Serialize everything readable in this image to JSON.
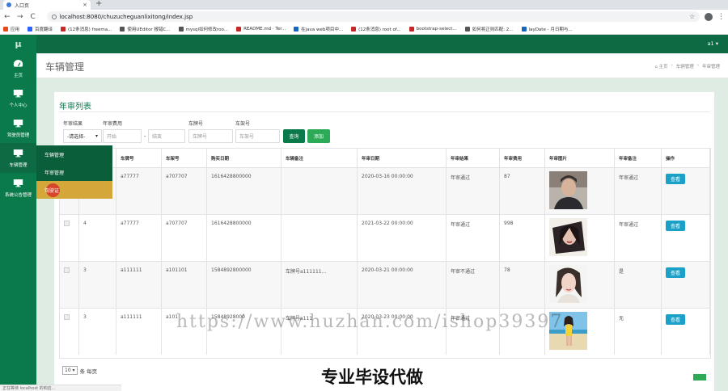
{
  "browser": {
    "tab_title": "入口页",
    "tab_close": "×",
    "new_tab": "+",
    "back": "←",
    "forward": "→",
    "reload": "C",
    "url": "localhost:8080/chuzucheguanlixitong/index.jsp",
    "star": "☆",
    "menu": "⋮",
    "bookmarks": [
      {
        "label": "应用",
        "color": "#e64a19"
      },
      {
        "label": "百度翻译",
        "color": "#2962ff"
      },
      {
        "label": "(12条消息) freema...",
        "color": "#c62828"
      },
      {
        "label": "使用UEditor 报错C...",
        "color": "#555555"
      },
      {
        "label": "mysql如何修改roo...",
        "color": "#555555"
      },
      {
        "label": "README.md · Ter...",
        "color": "#c62828"
      },
      {
        "label": "在java web项目中...",
        "color": "#1565c0"
      },
      {
        "label": "(12条消息) root of...",
        "color": "#c62828"
      },
      {
        "label": "bootstrap-select...",
        "color": "#c62828"
      },
      {
        "label": "如何将正则匹配: 2...",
        "color": "#555555"
      },
      {
        "label": "layDate - 月日期与...",
        "color": "#1565c0"
      }
    ]
  },
  "app": {
    "logo": "μ",
    "user": "a1 ▾",
    "sidebar": [
      {
        "label": "主页",
        "icon": "dashboard-icon"
      },
      {
        "label": "个人中心",
        "icon": "monitor-icon"
      },
      {
        "label": "驾驶员管理",
        "icon": "monitor-icon"
      },
      {
        "label": "车辆管理",
        "icon": "monitor-icon"
      },
      {
        "label": "系统公告管理",
        "icon": "monitor-icon"
      }
    ],
    "submenu": [
      "车辆管理",
      "年审管理",
      "驾驶证"
    ]
  },
  "page": {
    "title": "车辆管理",
    "breadcrumb": [
      "⌂ 主页",
      "›",
      "车辆管理",
      "›",
      "年审管理"
    ]
  },
  "panel": {
    "title": "年审列表",
    "filters": {
      "result_label": "年审结果",
      "result_value": "-请选择-",
      "fee_label": "年审费用",
      "fee_start_placeholder": "开始",
      "fee_sep": "-",
      "fee_end_placeholder": "结束",
      "plate_label": "车牌号",
      "plate_placeholder": "车牌号",
      "frame_label": "车架号",
      "frame_placeholder": "车架号",
      "search_btn": "查询",
      "add_btn": "添加"
    },
    "columns": [
      "",
      "",
      "车牌号",
      "车架号",
      "购买日期",
      "车辆备注",
      "年审日期",
      "年审结果",
      "年审费用",
      "年审图片",
      "年审备注",
      "操作"
    ],
    "rows": [
      {
        "idx": "",
        "plate": "a77777",
        "frame": "a707707",
        "buy_date": "1616428800000",
        "note": "",
        "date": "2020-03-16 00:00:00",
        "result": "年审通过",
        "fee": "87",
        "remark": "年审通过",
        "action": "查看",
        "photo": "man"
      },
      {
        "idx": "4",
        "plate": "a77777",
        "frame": "a707707",
        "buy_date": "1616428800000",
        "note": "",
        "date": "2021-03-22 00:00:00",
        "result": "年审通过",
        "fee": "998",
        "remark": "年审通过",
        "action": "查看",
        "photo": "woman-dark"
      },
      {
        "idx": "3",
        "plate": "a111111",
        "frame": "a101101",
        "buy_date": "1584892800000",
        "note": "车牌号a111111...",
        "date": "2020-03-21 00:00:00",
        "result": "年审不通过",
        "fee": "78",
        "remark": "是",
        "action": "查看",
        "photo": "woman-light"
      },
      {
        "idx": "3",
        "plate": "a111111",
        "frame": "a101",
        "buy_date": "15848928000",
        "note": "车牌号a111",
        "date": "2020-03-23 00:00:00",
        "result": "年审通过",
        "fee": "",
        "remark": "无",
        "action": "查看",
        "photo": "beach"
      }
    ],
    "page_size": "10 ▾",
    "page_size_suffix": "条 每页"
  },
  "overlay": {
    "watermark": "https://www.huzhan.com/ishop39397",
    "banner": "专业毕设代做"
  },
  "statusbar": "正在等待 localhost 的响应..."
}
